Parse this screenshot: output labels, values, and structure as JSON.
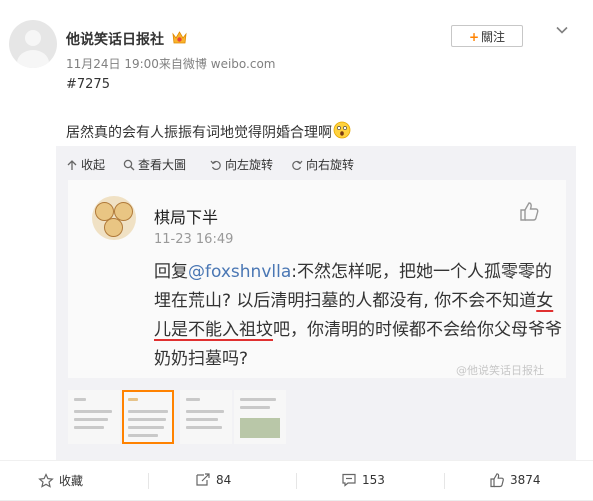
{
  "post": {
    "author": "他说笑话日报社",
    "meta": "11月24日 19:00来自微博 weibo.com",
    "follow_label": "關注",
    "post_id": "#7275",
    "text": "居然真的会有人振振有词地觉得阴婚合理啊"
  },
  "media_toolbar": {
    "collapse": "收起",
    "view_large": "查看大圖",
    "rotate_left": "向左旋转",
    "rotate_right": "向右旋转"
  },
  "embedded_comment": {
    "name": "棋局下半",
    "date": "11-23 16:49",
    "reply_prefix": "回复",
    "mention": "@foxshnvlla",
    "body_part1": ":不然怎样呢，把她一个人孤零零的埋在荒山? 以后清明扫墓的人都没有, 你不会不知道",
    "body_underlined": "女儿是不能入祖坟",
    "body_part2": "吧，你清明的时候都不会给你父母爷爷奶奶扫墓吗?",
    "watermark": "@他说笑话日报社"
  },
  "thumbnails": {
    "count": 4,
    "active_index": 1
  },
  "actions": {
    "favorite": "收藏",
    "repost": "84",
    "comment": "153",
    "like": "3874"
  },
  "colors": {
    "accent": "#ff8200",
    "mention": "#4a77b4",
    "underline": "#e03030"
  }
}
